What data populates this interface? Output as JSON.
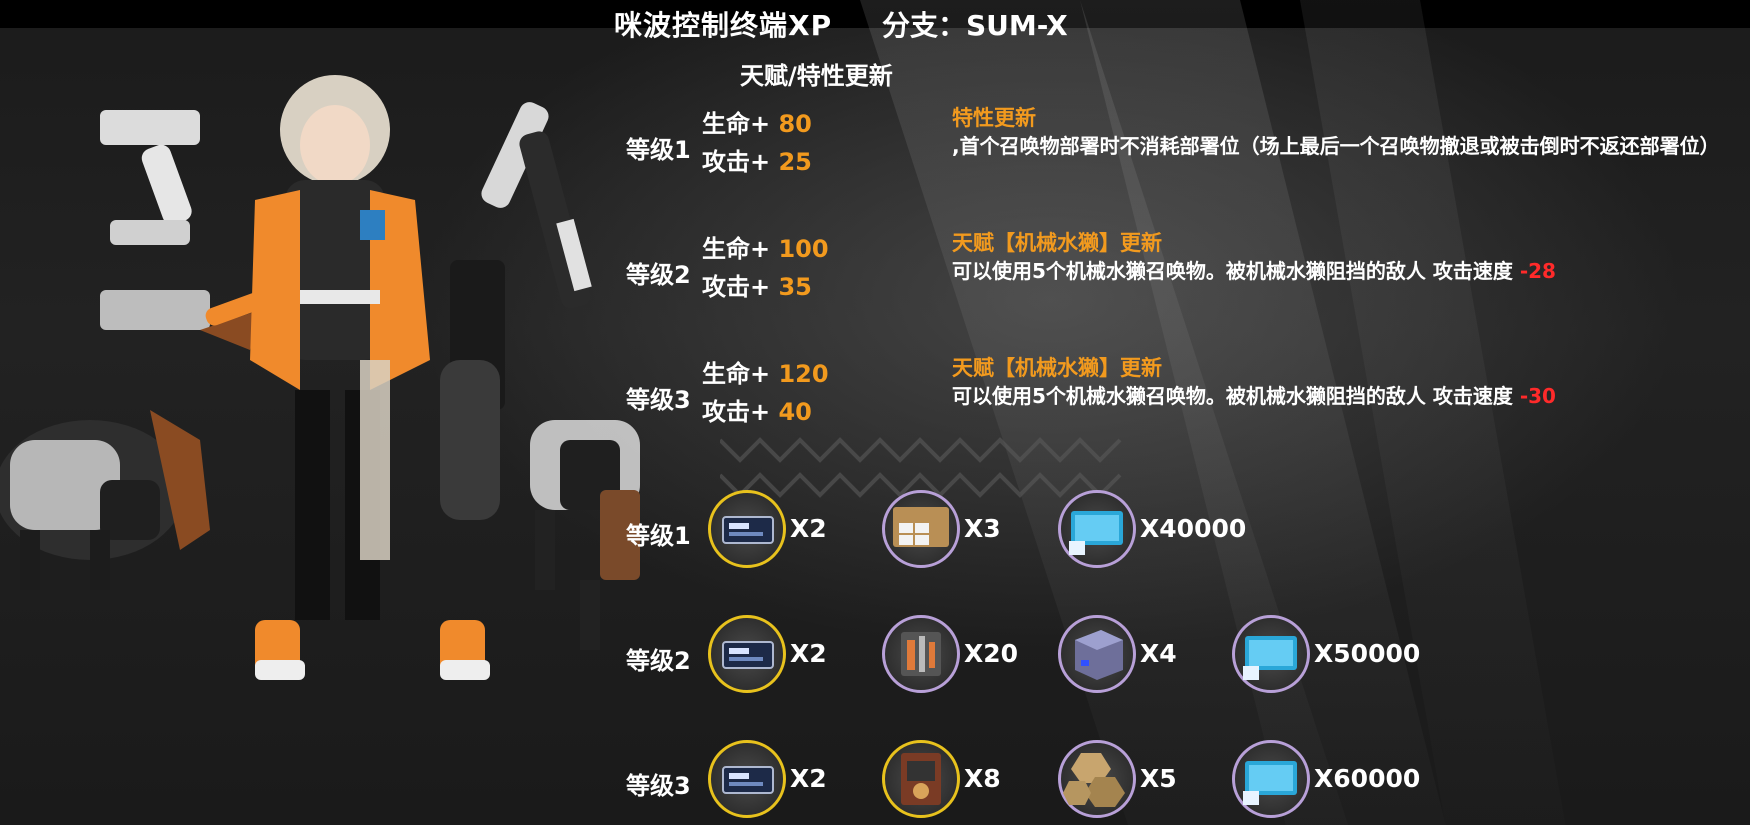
{
  "header": {
    "title": "咪波控制终端XP",
    "branch": "分支：SUM-X"
  },
  "talent_section": {
    "title": "天赋/特性更新",
    "levels": [
      {
        "label": "等级1",
        "hp_label": "生命+",
        "hp_value": "80",
        "atk_label": "攻击+",
        "atk_value": "25",
        "update_title": "特性更新",
        "desc": ",首个召唤物部署时不消耗部署位（场上最后一个召唤物撤退或被击倒时不返还部署位）",
        "desc_value": ""
      },
      {
        "label": "等级2",
        "hp_label": "生命+",
        "hp_value": "100",
        "atk_label": "攻击+",
        "atk_value": "35",
        "update_title": "天赋【机械水獭】更新",
        "desc": "可以使用5个机械水獭召唤物。被机械水獭阻挡的敌人 攻击速度 ",
        "desc_value": "-28"
      },
      {
        "label": "等级3",
        "hp_label": "生命+",
        "hp_value": "120",
        "atk_label": "攻击+",
        "atk_value": "40",
        "update_title": "天赋【机械水獭】更新",
        "desc": "可以使用5个机械水獭召唤物。被机械水獭阻挡的敌人 攻击速度 ",
        "desc_value": "-30"
      }
    ]
  },
  "cost_section": {
    "levels": [
      {
        "label": "等级1",
        "items": [
          {
            "icon": "module-data-block-icon",
            "rarity": "gold",
            "qty": "X2"
          },
          {
            "icon": "supply-box-icon",
            "rarity": "purple",
            "qty": "X3"
          },
          {
            "icon": "lmd-chip-icon",
            "rarity": "purple",
            "qty": "X40000"
          }
        ]
      },
      {
        "label": "等级2",
        "items": [
          {
            "icon": "module-data-block-icon",
            "rarity": "gold",
            "qty": "X2"
          },
          {
            "icon": "tool-kit-icon",
            "rarity": "purple",
            "qty": "X20"
          },
          {
            "icon": "crystal-cube-icon",
            "rarity": "purple",
            "qty": "X4"
          },
          {
            "icon": "lmd-chip-icon",
            "rarity": "purple",
            "qty": "X50000"
          }
        ]
      },
      {
        "label": "等级3",
        "items": [
          {
            "icon": "module-data-block-icon",
            "rarity": "gold",
            "qty": "X2"
          },
          {
            "icon": "device-icon",
            "rarity": "gold",
            "qty": "X8"
          },
          {
            "icon": "stone-hex-icon",
            "rarity": "purple",
            "qty": "X5"
          },
          {
            "icon": "lmd-chip-icon",
            "rarity": "purple",
            "qty": "X60000"
          }
        ]
      }
    ]
  },
  "colors": {
    "highlight": "#f29a1e",
    "negative": "#ff2a2a",
    "gold_ring": "#e8c21d",
    "purple_ring": "#b8a0d8"
  }
}
